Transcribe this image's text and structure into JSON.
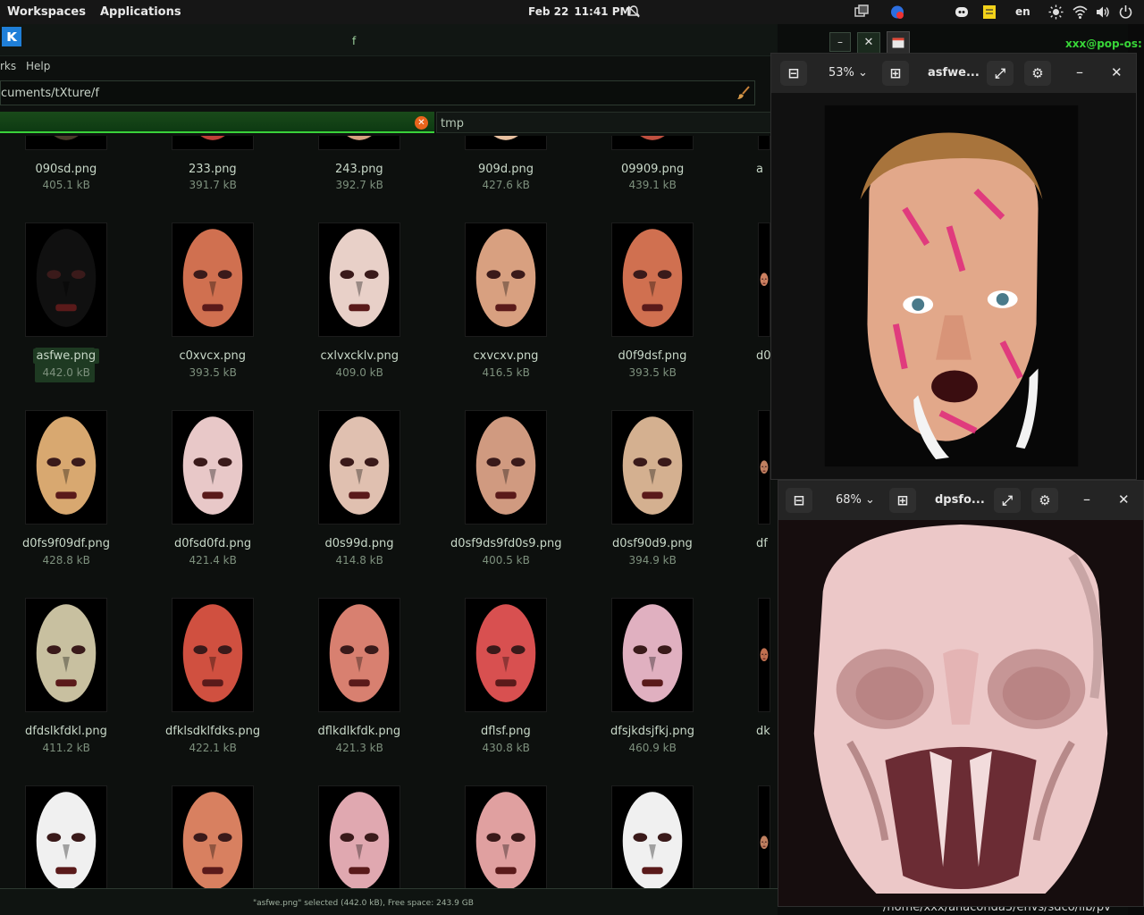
{
  "topbar": {
    "workspaces": "Workspaces",
    "applications": "Applications",
    "date": "Feb 22",
    "time": "11:41 PM",
    "lang": "en"
  },
  "file_manager": {
    "title": "f",
    "menu": [
      "rks",
      "Help"
    ],
    "path": "cuments/tXture/f",
    "tab_other": "tmp",
    "status": "\"asfwe.png\" selected (442.0 kB), Free space: 243.9 GB",
    "rows": [
      [
        {
          "name": "090sd.png",
          "size": "405.1 kB"
        },
        {
          "name": "233.png",
          "size": "391.7 kB"
        },
        {
          "name": "243.png",
          "size": "392.7 kB"
        },
        {
          "name": "909d.png",
          "size": "427.6 kB"
        },
        {
          "name": "09909.png",
          "size": "439.1 kB"
        },
        {
          "name": "a",
          "size": ""
        }
      ],
      [
        {
          "name": "asfwe.png",
          "size": "442.0 kB"
        },
        {
          "name": "c0xvcx.png",
          "size": "393.5 kB"
        },
        {
          "name": "cxlvxcklv.png",
          "size": "409.0 kB"
        },
        {
          "name": "cxvcxv.png",
          "size": "416.5 kB"
        },
        {
          "name": "d0f9dsf.png",
          "size": "393.5 kB"
        },
        {
          "name": "d0",
          "size": ""
        }
      ],
      [
        {
          "name": "d0fs9f09df.png",
          "size": "428.8 kB"
        },
        {
          "name": "d0fsd0fd.png",
          "size": "421.4 kB"
        },
        {
          "name": "d0s99d.png",
          "size": "414.8 kB"
        },
        {
          "name": "d0sf9ds9fd0s9.png",
          "size": "400.5 kB"
        },
        {
          "name": "d0sf90d9.png",
          "size": "394.9 kB"
        },
        {
          "name": "df",
          "size": ""
        }
      ],
      [
        {
          "name": "dfdslkfdkl.png",
          "size": "411.2 kB"
        },
        {
          "name": "dfklsdklfdks.png",
          "size": "422.1 kB"
        },
        {
          "name": "dflkdlkfdk.png",
          "size": "421.3 kB"
        },
        {
          "name": "dflsf.png",
          "size": "430.8 kB"
        },
        {
          "name": "dfsjkdsjfkj.png",
          "size": "460.9 kB"
        },
        {
          "name": "dkfl",
          "size": ""
        }
      ]
    ]
  },
  "viewer1": {
    "zoom": "53%",
    "title": "asfwe..."
  },
  "viewer2": {
    "zoom": "68%",
    "title": "dpsfo..."
  },
  "terminal": {
    "title": "xxx@pop-os: ~",
    "bottom": "/home/xxx/anaconda3/envs/sdco/lib/pv"
  },
  "colors": {
    "accent_green": "#3ad13a",
    "selection": "#1e3a22",
    "viewer_bg": "#242424"
  },
  "icons": [
    "bell-slash-icon",
    "discord-icon",
    "note-icon",
    "brightness-icon",
    "wifi-icon",
    "volume-icon",
    "power-icon",
    "zoom-out-icon",
    "zoom-in-icon",
    "fullscreen-icon",
    "gear-icon",
    "minimize-icon",
    "close-icon",
    "brush-icon"
  ]
}
